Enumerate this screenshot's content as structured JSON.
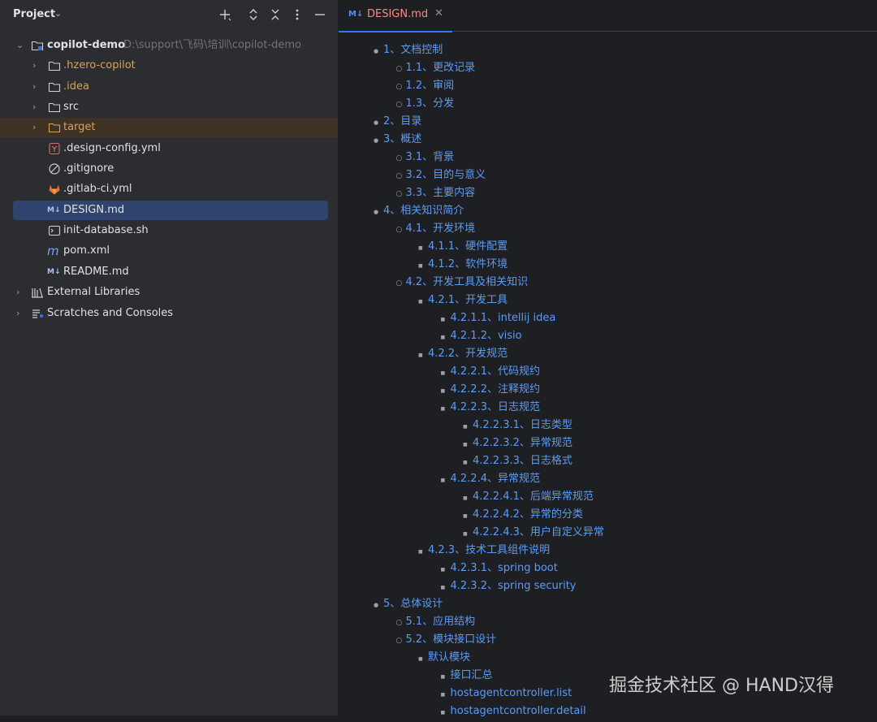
{
  "project": {
    "title": "Project",
    "tree": [
      {
        "label": "copilot-demo",
        "path": "D:\\support\\飞码\\培训\\copilot-demo",
        "type": "module",
        "expanded": true,
        "depth": 0
      },
      {
        "label": ".hzero-copilot",
        "type": "folder",
        "color": "orange",
        "depth": 1
      },
      {
        "label": ".idea",
        "type": "folder",
        "color": "orange",
        "depth": 1
      },
      {
        "label": "src",
        "type": "folder",
        "color": "white",
        "depth": 1
      },
      {
        "label": "target",
        "type": "folder-excluded",
        "color": "orange",
        "depth": 1
      },
      {
        "label": ".design-config.yml",
        "type": "yaml",
        "depth": 1
      },
      {
        "label": ".gitignore",
        "type": "gitignore",
        "depth": 1
      },
      {
        "label": ".gitlab-ci.yml",
        "type": "gitlab",
        "depth": 1
      },
      {
        "label": "DESIGN.md",
        "type": "markdown",
        "selected": true,
        "depth": 1
      },
      {
        "label": "init-database.sh",
        "type": "shell",
        "depth": 1
      },
      {
        "label": "pom.xml",
        "type": "maven",
        "depth": 1
      },
      {
        "label": "README.md",
        "type": "markdown",
        "depth": 1
      },
      {
        "label": "External Libraries",
        "type": "libraries",
        "depth": 0
      },
      {
        "label": "Scratches and Consoles",
        "type": "scratches",
        "depth": 0
      }
    ]
  },
  "editor": {
    "tab": {
      "label": "DESIGN.md",
      "icon": "M↓"
    },
    "toc": [
      {
        "text": "1、文档控制",
        "level": 0
      },
      {
        "text": "1.1、更改记录",
        "level": 1
      },
      {
        "text": "1.2、审阅",
        "level": 1
      },
      {
        "text": "1.3、分发",
        "level": 1
      },
      {
        "text": "2、目录",
        "level": 0
      },
      {
        "text": "3、概述",
        "level": 0
      },
      {
        "text": "3.1、背景",
        "level": 1
      },
      {
        "text": "3.2、目的与意义",
        "level": 1
      },
      {
        "text": "3.3、主要内容",
        "level": 1
      },
      {
        "text": "4、相关知识简介",
        "level": 0
      },
      {
        "text": "4.1、开发环境",
        "level": 1
      },
      {
        "text": "4.1.1、硬件配置",
        "level": 2
      },
      {
        "text": "4.1.2、软件环境",
        "level": 2
      },
      {
        "text": "4.2、开发工具及相关知识",
        "level": 1
      },
      {
        "text": "4.2.1、开发工具",
        "level": 2
      },
      {
        "text": "4.2.1.1、intellij idea",
        "level": 3
      },
      {
        "text": "4.2.1.2、visio",
        "level": 3
      },
      {
        "text": "4.2.2、开发规范",
        "level": 2
      },
      {
        "text": "4.2.2.1、代码规约",
        "level": 3
      },
      {
        "text": "4.2.2.2、注释规约",
        "level": 3
      },
      {
        "text": "4.2.2.3、日志规范",
        "level": 3
      },
      {
        "text": "4.2.2.3.1、日志类型",
        "level": 4
      },
      {
        "text": "4.2.2.3.2、异常规范",
        "level": 4
      },
      {
        "text": "4.2.2.3.3、日志格式",
        "level": 4
      },
      {
        "text": "4.2.2.4、异常规范",
        "level": 3
      },
      {
        "text": "4.2.2.4.1、后端异常规范",
        "level": 4
      },
      {
        "text": "4.2.2.4.2、异常的分类",
        "level": 4
      },
      {
        "text": "4.2.2.4.3、用户自定义异常",
        "level": 4
      },
      {
        "text": "4.2.3、技术工具组件说明",
        "level": 2
      },
      {
        "text": "4.2.3.1、spring boot",
        "level": 3
      },
      {
        "text": "4.2.3.2、spring security",
        "level": 3
      },
      {
        "text": "5、总体设计",
        "level": 0
      },
      {
        "text": "5.1、应用结构",
        "level": 1
      },
      {
        "text": "5.2、模块接口设计",
        "level": 1
      },
      {
        "text": "默认模块",
        "level": 2
      },
      {
        "text": "接口汇总",
        "level": 3
      },
      {
        "text": "hostagentcontroller.list",
        "level": 3
      },
      {
        "text": "hostagentcontroller.detail",
        "level": 3
      }
    ]
  },
  "watermark": "掘金技术社区 @ HAND汉得",
  "colors": {
    "link": "#5c9cf5",
    "orange": "#d6a45b",
    "selection": "#2e436e"
  }
}
